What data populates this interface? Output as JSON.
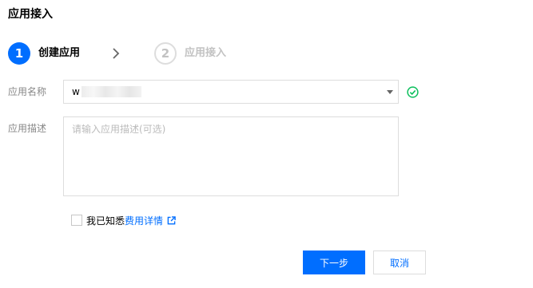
{
  "page": {
    "title": "应用接入"
  },
  "steps": [
    {
      "number": "1",
      "label": "创建应用",
      "state": "active"
    },
    {
      "number": "2",
      "label": "应用接入",
      "state": "inactive"
    }
  ],
  "form": {
    "app_name": {
      "label": "应用名称",
      "value": "w"
    },
    "app_desc": {
      "label": "应用描述",
      "value": "",
      "placeholder": "请输入应用描述(可选)"
    },
    "agreement": {
      "checked": false,
      "text": "我已知悉",
      "link_text": "费用详情"
    }
  },
  "buttons": {
    "next": "下一步",
    "cancel": "取消"
  },
  "icons": {
    "step_separator": "chevron-right-icon",
    "select_caret": "caret-down-icon",
    "valid": "check-circle-icon",
    "external_link": "external-link-icon"
  },
  "colors": {
    "primary": "#006eff",
    "success": "#0abf5b",
    "border": "#dddddd"
  }
}
